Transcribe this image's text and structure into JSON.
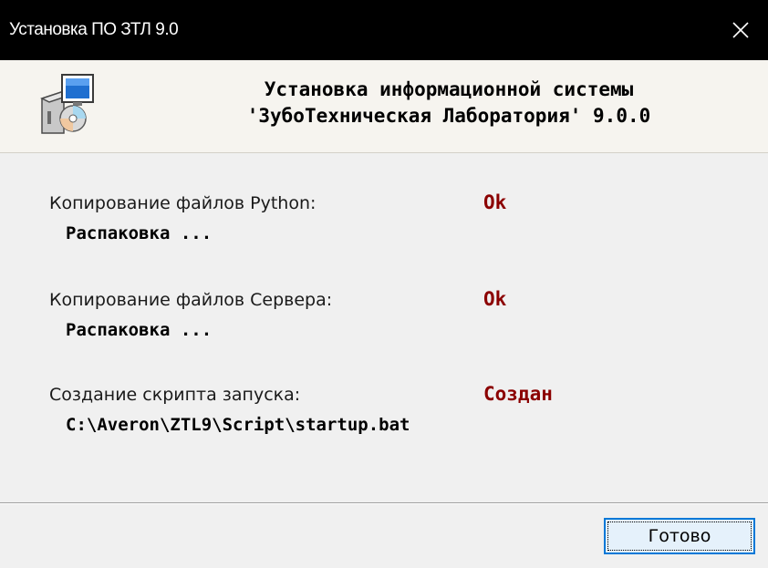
{
  "window": {
    "title": "Установка ПО ЗТЛ 9.0",
    "close_icon": "close-icon"
  },
  "header": {
    "icon": "installer-icon",
    "title_line1": "Установка информационной системы",
    "title_line2": "'ЗубоТехническая Лаборатория' 9.0.0"
  },
  "steps": [
    {
      "label": "Копирование файлов Python:",
      "status": "Ok",
      "detail": "Распаковка ..."
    },
    {
      "label": "Копирование файлов Сервера:",
      "status": "Ok",
      "detail": "Распаковка ..."
    },
    {
      "label": "Создание скрипта запуска:",
      "status": "Создан",
      "detail": "C:\\Averon\\ZTL9\\Script\\startup.bat"
    }
  ],
  "footer": {
    "done_label": "Готово"
  },
  "colors": {
    "status": "#8b0000",
    "titlebar": "#000000",
    "button_accent": "#0078d7"
  }
}
